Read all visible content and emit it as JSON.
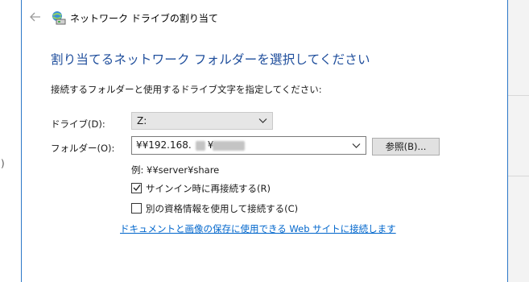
{
  "window": {
    "title": "ネットワーク ドライブの割り当て",
    "back_icon": "arrow-left-icon",
    "title_icon": "network-drive-icon"
  },
  "main": {
    "heading": "割り当てるネットワーク フォルダーを選択してください",
    "instruction": "接続するフォルダーと使用するドライブ文字を指定してください:"
  },
  "form": {
    "drive_label": "ドライブ(D):",
    "drive_value": "Z:",
    "folder_label": "フォルダー(O):",
    "folder_value": "¥¥192.168.",
    "folder_value_suffix": "¥",
    "browse_label": "参照(B)...",
    "example_text": "例: ¥¥server¥share",
    "reconnect_label": "サインイン時に再接続する(R)",
    "reconnect_checked": true,
    "credentials_label": "別の資格情報を使用して接続する(C)",
    "credentials_checked": false,
    "link_text": "ドキュメントと画像の保存に使用できる Web サイトに接続します"
  },
  "colors": {
    "heading": "#1f4e9c",
    "link": "#0066cc",
    "dialog_border": "#2b78c8"
  }
}
